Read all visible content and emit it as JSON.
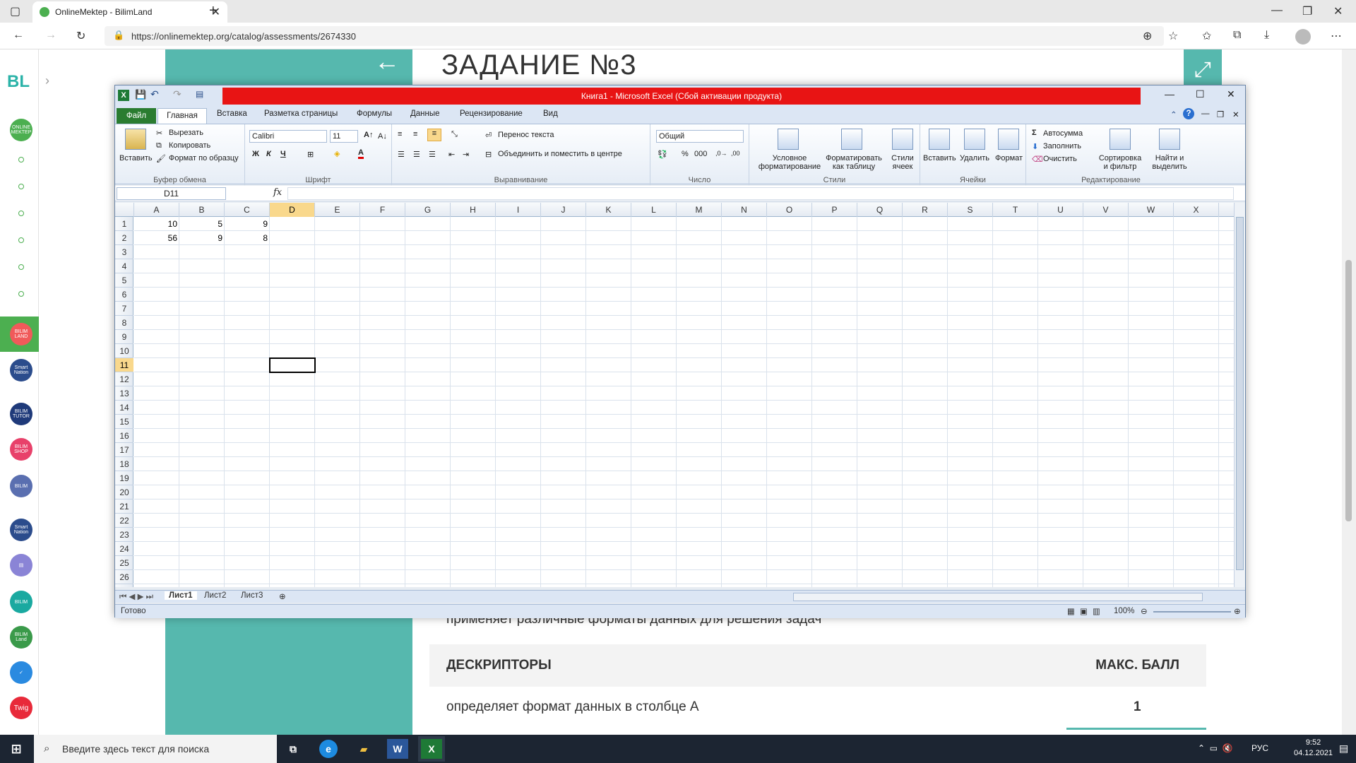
{
  "browser": {
    "tab_title": "OnlineMektep - BilimLand",
    "new_tab_symbol": "+",
    "url": "https://onlinemektep.org/catalog/assessments/2674330"
  },
  "page": {
    "logo": "BL",
    "task_title": "ЗАДАНИЕ №3",
    "partial_text": "применяет различные форматы данных для решения задач",
    "table_header_left": "ДЕСКРИПТОРЫ",
    "table_header_right": "МАКС. БАЛЛ",
    "row1_text": "определяет формат данных в столбце A",
    "row1_score": "1",
    "nav_icons": [
      {
        "label": "ONLINE MEKTEP",
        "color": "#4caf50"
      },
      {
        "label": "BILIM LAND",
        "color": "#f05a5a"
      },
      {
        "label": "Smart Nation",
        "color": "#2b4c8c"
      },
      {
        "label": "BILIM TUTOR",
        "color": "#1f3a7a"
      },
      {
        "label": "BILIM SHOP",
        "color": "#e8416a"
      },
      {
        "label": "BILIM",
        "color": "#5a6fb0"
      },
      {
        "label": "Smart Nation",
        "color": "#2b4c8c"
      },
      {
        "label": "",
        "color": "#8a84d6"
      },
      {
        "label": "BILIM",
        "color": "#1aa9a0"
      },
      {
        "label": "BILIM Land",
        "color": "#3a9a4a"
      },
      {
        "label": "",
        "color": "#2a8ae0"
      },
      {
        "label": "Twig",
        "color": "#e82a3a"
      }
    ]
  },
  "excel": {
    "title": "Книга1 - Microsoft Excel (Сбой активации продукта)",
    "tabs": [
      "Файл",
      "Главная",
      "Вставка",
      "Разметка страницы",
      "Формулы",
      "Данные",
      "Рецензирование",
      "Вид"
    ],
    "clipboard": {
      "paste": "Вставить",
      "cut": "Вырезать",
      "copy": "Копировать",
      "format_painter": "Формат по образцу",
      "label": "Буфер обмена"
    },
    "font": {
      "name": "Calibri",
      "size": "11",
      "bold": "Ж",
      "italic": "К",
      "underline": "Ч",
      "label": "Шрифт"
    },
    "alignment": {
      "wrap": "Перенос текста",
      "merge": "Объединить и поместить в центре",
      "label": "Выравнивание"
    },
    "number": {
      "format": "Общий",
      "label": "Число"
    },
    "styles": {
      "conditional": "Условное форматирование",
      "as_table": "Форматировать как таблицу",
      "cell_styles": "Стили ячеек",
      "label": "Стили"
    },
    "cells_grp": {
      "insert": "Вставить",
      "delete": "Удалить",
      "format": "Формат",
      "label": "Ячейки"
    },
    "editing": {
      "autosum": "Автосумма",
      "fill": "Заполнить",
      "clear": "Очистить",
      "sort": "Сортировка и фильтр",
      "find": "Найти и выделить",
      "label": "Редактирование"
    },
    "name_box": "D11",
    "fx": "fx",
    "columns": [
      "A",
      "B",
      "C",
      "D",
      "E",
      "F",
      "G",
      "H",
      "I",
      "J",
      "K",
      "L",
      "M",
      "N",
      "O",
      "P",
      "Q",
      "R",
      "S",
      "T",
      "U",
      "V",
      "W",
      "X"
    ],
    "rows": [
      "1",
      "2",
      "3",
      "4",
      "5",
      "6",
      "7",
      "8",
      "9",
      "10",
      "11",
      "12",
      "13",
      "14",
      "15",
      "16",
      "17",
      "18",
      "19",
      "20",
      "21",
      "22",
      "23",
      "24",
      "25",
      "26"
    ],
    "cells": [
      {
        "ref": "A1",
        "value": "10"
      },
      {
        "ref": "B1",
        "value": "5"
      },
      {
        "ref": "C1",
        "value": "9"
      },
      {
        "ref": "A2",
        "value": "56"
      },
      {
        "ref": "B2",
        "value": "9"
      },
      {
        "ref": "C2",
        "value": "8"
      }
    ],
    "sheets": [
      "Лист1",
      "Лист2",
      "Лист3"
    ],
    "status": "Готово",
    "zoom": "100%"
  },
  "taskbar": {
    "search_placeholder": "Введите здесь текст для поиска",
    "lang": "РУС",
    "time": "9:52",
    "date": "04.12.2021"
  }
}
